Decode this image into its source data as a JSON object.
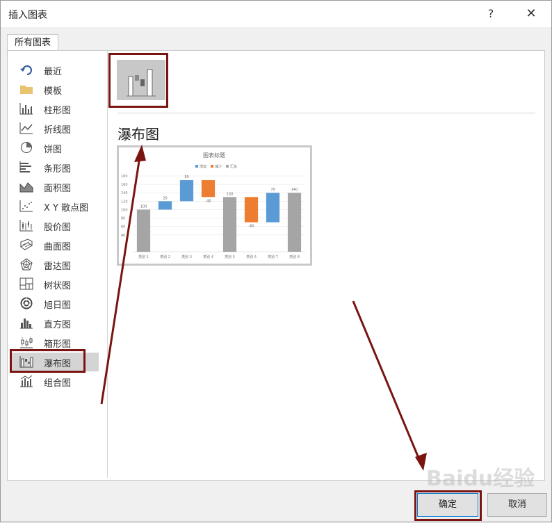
{
  "dialog": {
    "title": "插入图表",
    "help": "?",
    "close": "✕"
  },
  "tab": {
    "label": "所有图表"
  },
  "sidebar": {
    "items": [
      {
        "label": "最近",
        "icon": "recent-icon"
      },
      {
        "label": "模板",
        "icon": "folder-icon"
      },
      {
        "label": "柱形图",
        "icon": "column-chart-icon"
      },
      {
        "label": "折线图",
        "icon": "line-chart-icon"
      },
      {
        "label": "饼图",
        "icon": "pie-chart-icon"
      },
      {
        "label": "条形图",
        "icon": "bar-chart-icon"
      },
      {
        "label": "面积图",
        "icon": "area-chart-icon"
      },
      {
        "label": "X Y 散点图",
        "icon": "scatter-chart-icon"
      },
      {
        "label": "股价图",
        "icon": "stock-chart-icon"
      },
      {
        "label": "曲面图",
        "icon": "surface-chart-icon"
      },
      {
        "label": "雷达图",
        "icon": "radar-chart-icon"
      },
      {
        "label": "树状图",
        "icon": "treemap-chart-icon"
      },
      {
        "label": "旭日图",
        "icon": "sunburst-chart-icon"
      },
      {
        "label": "直方图",
        "icon": "histogram-chart-icon"
      },
      {
        "label": "箱形图",
        "icon": "box-whisker-chart-icon"
      },
      {
        "label": "瀑布图",
        "icon": "waterfall-chart-icon"
      },
      {
        "label": "组合图",
        "icon": "combo-chart-icon"
      }
    ],
    "selected": "瀑布图"
  },
  "main": {
    "chart_name": "瀑布图"
  },
  "chart_data": {
    "type": "bar",
    "title": "图表标题",
    "legend": [
      "增加",
      "减少",
      "汇总"
    ],
    "ylim": [
      0,
      180
    ],
    "yticks": [
      "180",
      "160",
      "140",
      "120",
      "100",
      "80",
      "60",
      "40"
    ],
    "categories": [
      "类别 1",
      "类别 2",
      "类别 3",
      "类别 4",
      "类别 5",
      "类别 6",
      "类别 7",
      "类别 8"
    ],
    "values": [
      100,
      20,
      50,
      -40,
      130,
      -60,
      70,
      140
    ],
    "value_labels": [
      "100",
      "20",
      "50",
      "-40",
      "130",
      "-60",
      "70",
      "140"
    ],
    "kinds": [
      "total",
      "increase",
      "increase",
      "decrease",
      "total",
      "decrease",
      "increase",
      "total"
    ],
    "colors": {
      "increase": "#5b9bd5",
      "decrease": "#ed7d31",
      "total": "#a5a5a5"
    }
  },
  "buttons": {
    "ok": "确定",
    "cancel": "取消"
  },
  "watermark": "Baidu经验",
  "colors": {
    "annotation": "#7a1410",
    "selection": "#d4d4d4",
    "ok_border": "#0078d7"
  }
}
